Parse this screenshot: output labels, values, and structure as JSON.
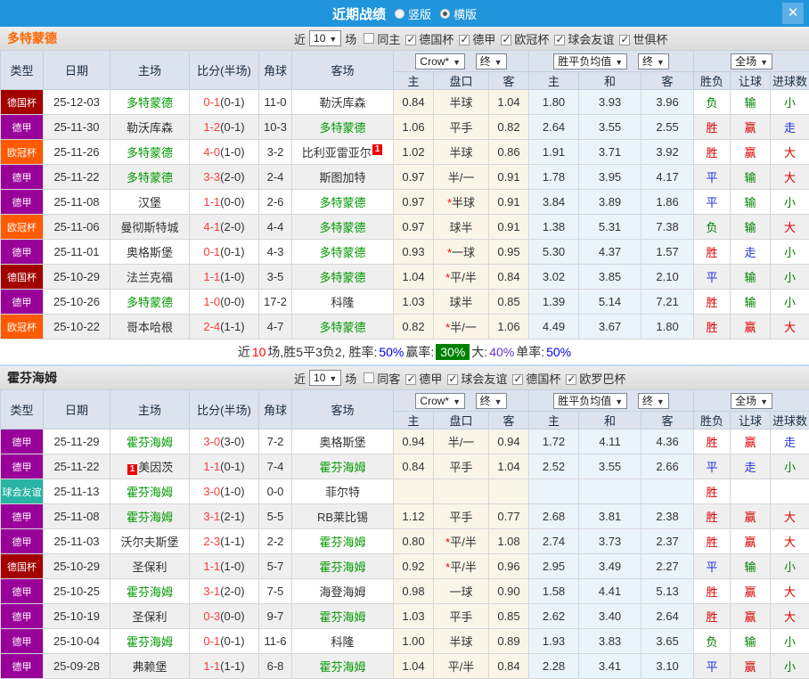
{
  "colors": {
    "topbar": "#2095db",
    "close_bg": "#5aafe8",
    "team1": "#ff6600",
    "team2": "#222222",
    "team_highlight_green": "#009900",
    "score_red": "#fe3b3b",
    "type_badges": {
      "德国杯": "#a30000",
      "德甲": "#990099",
      "欧冠杯": "#ff5a00",
      "球会友谊": "#29b3a5"
    },
    "result_text": {
      "r": "#dd0000",
      "g": "#008000",
      "b": "#2233dd"
    },
    "win_rate_badge_bg": "#008000"
  },
  "titlebar": {
    "title": "近期战绩",
    "close_glyph": "✕",
    "radios": [
      {
        "label": "竖版",
        "selected": false
      },
      {
        "label": "横版",
        "selected": true
      }
    ]
  },
  "columns": {
    "type": "类型",
    "date": "日期",
    "home": "主场",
    "score": "比分(半场)",
    "corner": "角球",
    "away": "客场",
    "dd_crow": "Crow*",
    "dd_final": "终",
    "dd_avg": "胜平负均值",
    "dd_full": "全场",
    "arrow": "▼",
    "sub": [
      "主",
      "盘口",
      "客",
      "主",
      "和",
      "客",
      "胜负",
      "让球",
      "进球数"
    ]
  },
  "sections": [
    {
      "team": "多特蒙德",
      "filter": {
        "near": "近",
        "count": "10",
        "games": "场",
        "same": "同主",
        "same_checked": false,
        "leagues": [
          "德国杯",
          "德甲",
          "欧冠杯",
          "球会友谊",
          "世俱杯"
        ]
      },
      "rows": [
        {
          "type": "德国杯",
          "date": "25-12-03",
          "home": {
            "n": "多特蒙德",
            "g": 1
          },
          "ft": "0-1",
          "ht": "(0-1)",
          "corner": "11-0",
          "away": {
            "n": "勒沃库森"
          },
          "o1": [
            "0.84",
            "半球",
            "1.04"
          ],
          "o2": [
            "1.80",
            "3.93",
            "3.96"
          ],
          "res": [
            [
              "负",
              "g"
            ],
            [
              "输",
              "g"
            ],
            [
              "小",
              "g"
            ]
          ]
        },
        {
          "type": "德甲",
          "date": "25-11-30",
          "home": {
            "n": "勒沃库森"
          },
          "ft": "1-2",
          "ht": "(0-1)",
          "corner": "10-3",
          "away": {
            "n": "多特蒙德",
            "g": 1
          },
          "o1": [
            "1.06",
            "平手",
            "0.82"
          ],
          "o2": [
            "2.64",
            "3.55",
            "2.55"
          ],
          "res": [
            [
              "胜",
              "r"
            ],
            [
              "赢",
              "r"
            ],
            [
              "走",
              "b"
            ]
          ]
        },
        {
          "type": "欧冠杯",
          "date": "25-11-26",
          "home": {
            "n": "多特蒙德",
            "g": 1
          },
          "ft": "4-0",
          "ht": "(1-0)",
          "corner": "3-2",
          "away": {
            "n": "比利亚雷亚尔",
            "badge": "1",
            "badge_pos": "after"
          },
          "o1": [
            "1.02",
            "半球",
            "0.86"
          ],
          "o2": [
            "1.91",
            "3.71",
            "3.92"
          ],
          "res": [
            [
              "胜",
              "r"
            ],
            [
              "赢",
              "r"
            ],
            [
              "大",
              "r"
            ]
          ]
        },
        {
          "type": "德甲",
          "date": "25-11-22",
          "home": {
            "n": "多特蒙德",
            "g": 1
          },
          "ft": "3-3",
          "ht": "(2-0)",
          "corner": "2-4",
          "away": {
            "n": "斯图加特"
          },
          "o1": [
            "0.97",
            "半/一",
            "0.91"
          ],
          "o2": [
            "1.78",
            "3.95",
            "4.17"
          ],
          "res": [
            [
              "平",
              "b"
            ],
            [
              "输",
              "g"
            ],
            [
              "大",
              "r"
            ]
          ]
        },
        {
          "type": "德甲",
          "date": "25-11-08",
          "home": {
            "n": "汉堡"
          },
          "ft": "1-1",
          "ht": "(0-0)",
          "corner": "2-6",
          "away": {
            "n": "多特蒙德",
            "g": 1
          },
          "o1": [
            "0.97",
            "*半球",
            "0.91"
          ],
          "o2": [
            "3.84",
            "3.89",
            "1.86"
          ],
          "res": [
            [
              "平",
              "b"
            ],
            [
              "输",
              "g"
            ],
            [
              "小",
              "g"
            ]
          ]
        },
        {
          "type": "欧冠杯",
          "date": "25-11-06",
          "home": {
            "n": "曼彻斯特城"
          },
          "ft": "4-1",
          "ht": "(2-0)",
          "corner": "4-4",
          "away": {
            "n": "多特蒙德",
            "g": 1
          },
          "o1": [
            "0.97",
            "球半",
            "0.91"
          ],
          "o2": [
            "1.38",
            "5.31",
            "7.38"
          ],
          "res": [
            [
              "负",
              "g"
            ],
            [
              "输",
              "g"
            ],
            [
              "大",
              "r"
            ]
          ]
        },
        {
          "type": "德甲",
          "date": "25-11-01",
          "home": {
            "n": "奥格斯堡"
          },
          "ft": "0-1",
          "ht": "(0-1)",
          "corner": "4-3",
          "away": {
            "n": "多特蒙德",
            "g": 1
          },
          "o1": [
            "0.93",
            "*一球",
            "0.95"
          ],
          "o2": [
            "5.30",
            "4.37",
            "1.57"
          ],
          "res": [
            [
              "胜",
              "r"
            ],
            [
              "走",
              "b"
            ],
            [
              "小",
              "g"
            ]
          ]
        },
        {
          "type": "德国杯",
          "date": "25-10-29",
          "home": {
            "n": "法兰克福"
          },
          "ft": "1-1",
          "ht": "(1-0)",
          "corner": "3-5",
          "away": {
            "n": "多特蒙德",
            "g": 1
          },
          "o1": [
            "1.04",
            "*平/半",
            "0.84"
          ],
          "o2": [
            "3.02",
            "3.85",
            "2.10"
          ],
          "res": [
            [
              "平",
              "b"
            ],
            [
              "输",
              "g"
            ],
            [
              "小",
              "g"
            ]
          ]
        },
        {
          "type": "德甲",
          "date": "25-10-26",
          "home": {
            "n": "多特蒙德",
            "g": 1
          },
          "ft": "1-0",
          "ht": "(0-0)",
          "corner": "17-2",
          "away": {
            "n": "科隆"
          },
          "o1": [
            "1.03",
            "球半",
            "0.85"
          ],
          "o2": [
            "1.39",
            "5.14",
            "7.21"
          ],
          "res": [
            [
              "胜",
              "r"
            ],
            [
              "输",
              "g"
            ],
            [
              "小",
              "g"
            ]
          ]
        },
        {
          "type": "欧冠杯",
          "date": "25-10-22",
          "home": {
            "n": "哥本哈根"
          },
          "ft": "2-4",
          "ht": "(1-1)",
          "corner": "4-7",
          "away": {
            "n": "多特蒙德",
            "g": 1
          },
          "o1": [
            "0.82",
            "*半/一",
            "1.06"
          ],
          "o2": [
            "4.49",
            "3.67",
            "1.80"
          ],
          "res": [
            [
              "胜",
              "r"
            ],
            [
              "赢",
              "r"
            ],
            [
              "大",
              "r"
            ]
          ]
        }
      ],
      "summary": [
        {
          "t": "近",
          "c": "k"
        },
        {
          "t": "10",
          "c": "r"
        },
        {
          "t": "场,胜5平3负2, 胜率:",
          "c": "k"
        },
        {
          "t": "50%",
          "c": "b"
        },
        {
          "t": " 赢率:",
          "c": "k"
        },
        {
          "t": "30%",
          "c": "badge"
        },
        {
          "t": " 大:",
          "c": "k"
        },
        {
          "t": "40%",
          "c": "v"
        },
        {
          "t": " 单率:",
          "c": "k"
        },
        {
          "t": "50%",
          "c": "b"
        }
      ]
    },
    {
      "team": "霍芬海姆",
      "filter": {
        "near": "近",
        "count": "10",
        "games": "场",
        "same": "同客",
        "same_checked": false,
        "leagues": [
          "德甲",
          "球会友谊",
          "德国杯",
          "欧罗巴杯"
        ]
      },
      "rows": [
        {
          "type": "德甲",
          "date": "25-11-29",
          "home": {
            "n": "霍芬海姆",
            "g": 1
          },
          "ft": "3-0",
          "ht": "(3-0)",
          "corner": "7-2",
          "away": {
            "n": "奥格斯堡"
          },
          "o1": [
            "0.94",
            "半/一",
            "0.94"
          ],
          "o2": [
            "1.72",
            "4.11",
            "4.36"
          ],
          "res": [
            [
              "胜",
              "r"
            ],
            [
              "赢",
              "r"
            ],
            [
              "走",
              "b"
            ]
          ]
        },
        {
          "type": "德甲",
          "date": "25-11-22",
          "home": {
            "n": "美因茨",
            "badge": "1",
            "badge_pos": "before"
          },
          "ft": "1-1",
          "ht": "(0-1)",
          "corner": "7-4",
          "away": {
            "n": "霍芬海姆",
            "g": 1
          },
          "o1": [
            "0.84",
            "平手",
            "1.04"
          ],
          "o2": [
            "2.52",
            "3.55",
            "2.66"
          ],
          "res": [
            [
              "平",
              "b"
            ],
            [
              "走",
              "b"
            ],
            [
              "小",
              "g"
            ]
          ]
        },
        {
          "type": "球会友谊",
          "date": "25-11-13",
          "home": {
            "n": "霍芬海姆",
            "g": 1
          },
          "ft": "3-0",
          "ht": "(1-0)",
          "corner": "0-0",
          "away": {
            "n": "菲尔特"
          },
          "o1": [
            "",
            "",
            ""
          ],
          "o2": [
            "",
            "",
            ""
          ],
          "res": [
            [
              "胜",
              "r"
            ],
            [
              "",
              ""
            ],
            [
              "",
              ""
            ]
          ]
        },
        {
          "type": "德甲",
          "date": "25-11-08",
          "home": {
            "n": "霍芬海姆",
            "g": 1
          },
          "ft": "3-1",
          "ht": "(2-1)",
          "corner": "5-5",
          "away": {
            "n": "RB莱比锡"
          },
          "o1": [
            "1.12",
            "平手",
            "0.77"
          ],
          "o2": [
            "2.68",
            "3.81",
            "2.38"
          ],
          "res": [
            [
              "胜",
              "r"
            ],
            [
              "赢",
              "r"
            ],
            [
              "大",
              "r"
            ]
          ]
        },
        {
          "type": "德甲",
          "date": "25-11-03",
          "home": {
            "n": "沃尔夫斯堡"
          },
          "ft": "2-3",
          "ht": "(1-1)",
          "corner": "2-2",
          "away": {
            "n": "霍芬海姆",
            "g": 1
          },
          "o1": [
            "0.80",
            "*平/半",
            "1.08"
          ],
          "o2": [
            "2.74",
            "3.73",
            "2.37"
          ],
          "res": [
            [
              "胜",
              "r"
            ],
            [
              "赢",
              "r"
            ],
            [
              "大",
              "r"
            ]
          ]
        },
        {
          "type": "德国杯",
          "date": "25-10-29",
          "home": {
            "n": "圣保利"
          },
          "ft": "1-1",
          "ht": "(1-0)",
          "corner": "5-7",
          "away": {
            "n": "霍芬海姆",
            "g": 1
          },
          "o1": [
            "0.92",
            "*平/半",
            "0.96"
          ],
          "o2": [
            "2.95",
            "3.49",
            "2.27"
          ],
          "res": [
            [
              "平",
              "b"
            ],
            [
              "输",
              "g"
            ],
            [
              "小",
              "g"
            ]
          ]
        },
        {
          "type": "德甲",
          "date": "25-10-25",
          "home": {
            "n": "霍芬海姆",
            "g": 1
          },
          "ft": "3-1",
          "ht": "(2-0)",
          "corner": "7-5",
          "away": {
            "n": "海登海姆"
          },
          "o1": [
            "0.98",
            "一球",
            "0.90"
          ],
          "o2": [
            "1.58",
            "4.41",
            "5.13"
          ],
          "res": [
            [
              "胜",
              "r"
            ],
            [
              "赢",
              "r"
            ],
            [
              "大",
              "r"
            ]
          ]
        },
        {
          "type": "德甲",
          "date": "25-10-19",
          "home": {
            "n": "圣保利"
          },
          "ft": "0-3",
          "ht": "(0-0)",
          "corner": "9-7",
          "away": {
            "n": "霍芬海姆",
            "g": 1
          },
          "o1": [
            "1.03",
            "平手",
            "0.85"
          ],
          "o2": [
            "2.62",
            "3.40",
            "2.64"
          ],
          "res": [
            [
              "胜",
              "r"
            ],
            [
              "赢",
              "r"
            ],
            [
              "大",
              "r"
            ]
          ]
        },
        {
          "type": "德甲",
          "date": "25-10-04",
          "home": {
            "n": "霍芬海姆",
            "g": 1
          },
          "ft": "0-1",
          "ht": "(0-1)",
          "corner": "11-6",
          "away": {
            "n": "科隆"
          },
          "o1": [
            "1.00",
            "半球",
            "0.89"
          ],
          "o2": [
            "1.93",
            "3.83",
            "3.65"
          ],
          "res": [
            [
              "负",
              "g"
            ],
            [
              "输",
              "g"
            ],
            [
              "小",
              "g"
            ]
          ]
        },
        {
          "type": "德甲",
          "date": "25-09-28",
          "home": {
            "n": "弗赖堡"
          },
          "ft": "1-1",
          "ht": "(1-1)",
          "corner": "6-8",
          "away": {
            "n": "霍芬海姆",
            "g": 1
          },
          "o1": [
            "1.04",
            "平/半",
            "0.84"
          ],
          "o2": [
            "2.28",
            "3.41",
            "3.10"
          ],
          "res": [
            [
              "平",
              "b"
            ],
            [
              "赢",
              "r"
            ],
            [
              "小",
              "g"
            ]
          ]
        }
      ],
      "summary": null
    }
  ]
}
